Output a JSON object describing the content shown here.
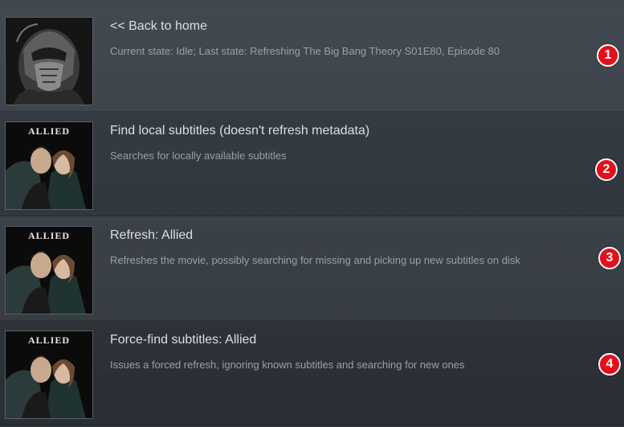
{
  "items": [
    {
      "title": "<< Back to home",
      "description": "Current state: Idle; Last state: Refreshing The Big Bang Theory S01E80, Episode 80",
      "thumbnail": "masked-figure-artwork",
      "badge": "1"
    },
    {
      "title": "Find local subtitles (doesn't refresh metadata)",
      "description": "Searches for locally available subtitles",
      "thumbnail": "allied-poster",
      "poster_text": "ALLIED",
      "badge": "2"
    },
    {
      "title": "Refresh: Allied",
      "description": "Refreshes the movie, possibly searching for missing and picking up new subtitles on disk",
      "thumbnail": "allied-poster",
      "poster_text": "ALLIED",
      "badge": "3"
    },
    {
      "title": "Force-find subtitles: Allied",
      "description": "Issues a forced refresh, ignoring known subtitles and searching for new ones",
      "thumbnail": "allied-poster",
      "poster_text": "ALLIED",
      "badge": "4"
    }
  ],
  "colors": {
    "badge": "#e3101b",
    "title_text": "#dcdfe3",
    "description_text": "#9aa0a8"
  }
}
